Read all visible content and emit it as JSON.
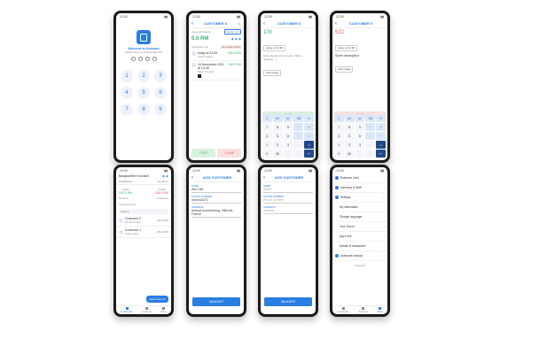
{
  "status_time": "12:00",
  "pin_screen": {
    "title": "Welcome to Konnash",
    "subtitle": "Please enter your Konnash PIN",
    "keys": [
      "1",
      "2",
      "3",
      "4",
      "5",
      "6",
      "7",
      "8",
      "9"
    ]
  },
  "customer_screen": {
    "title": "CUSTOMER 0",
    "balance_label": "General balance",
    "balance_badge": "Settled at 0",
    "balance_value": "0.0 RM",
    "operations_label": "Operations (2)",
    "report_label": "Generate report",
    "transactions": [
      {
        "date": "today at 22:36",
        "note": "Kevin, Gavin",
        "amount": "180.0 RM",
        "color": "green"
      },
      {
        "date": "16 November 2021 at 14:48",
        "note": "Bank Transfer",
        "amount": "+60.0 RM",
        "color": "green"
      }
    ],
    "got_label": "I GOT",
    "gave_label": "I GAVE"
  },
  "calc_green": {
    "title": "CUSTOMER 0",
    "amount": "100",
    "date_chip": "today at 22:38",
    "note_placeholder": "Enter details (Items name, Bill no, Quantity, ...)",
    "image_chip": "Add image",
    "save": "SAVE"
  },
  "calc_red": {
    "title": "CUSTOMER 0",
    "amount": "522",
    "date_chip": "today at 22:38",
    "note": "Some description",
    "image_chip": "Add image",
    "save": "SAVE"
  },
  "calc_keys": [
    "C",
    "M+",
    "M-",
    "⌫",
    "%",
    "7",
    "8",
    "9",
    "÷",
    "×",
    "4",
    "5",
    "6",
    "−",
    "+",
    "1",
    "2",
    "3",
    ".",
    "=",
    "0",
    "00",
    ",",
    "·",
    "↵"
  ],
  "list_screen": {
    "business": "Bangladeshi Konnash",
    "tabs": [
      "Customers",
      "Suppliers"
    ],
    "got_label": "I GOT",
    "gave_label": "I GAVE",
    "got_value": "100.0 RM",
    "gave_value": "186.0 RM",
    "reports": "Reports",
    "collection": "Collection",
    "customers_label": "Customers (2)",
    "search_placeholder": "Search",
    "customers": [
      {
        "name": "Customer 0",
        "sub": "18 hours ago",
        "amount": "100.0 RM",
        "color": "green"
      },
      {
        "name": "Customer 1",
        "sub": "3 days ago",
        "amount": "180.0 RM",
        "color": "red"
      }
    ],
    "add_button": "Add customer",
    "nav": [
      "Customers",
      "Analysis",
      "More"
    ]
  },
  "add_filled": {
    "title": "ADD CUSTOMER",
    "name_label": "NAME",
    "name_value": "Ann Dell",
    "phone_label": "PHONE NUMBER",
    "phone_value": "0xxxx44271",
    "address_label": "ADDRESS",
    "address_value": "avenue kronenbourg, Hillcroft, France",
    "save": "VALIDATE"
  },
  "add_empty": {
    "title": "ADD CUSTOMER",
    "name_label": "NAME",
    "name_value": "Name",
    "phone_label": "PHONE NUMBER",
    "phone_value": "Phone number",
    "address_label": "ADDRESS",
    "address_value": "Address",
    "save": "VALIDATE"
  },
  "settings_screen": {
    "items": [
      {
        "label": "Business Card",
        "sub": false
      },
      {
        "label": "Inventory & Staff",
        "sub": false
      },
      {
        "label": "Settings",
        "sub": false
      },
      {
        "label": "My information",
        "sub": true
      },
      {
        "label": "Change language",
        "sub": true
      },
      {
        "label": "Your Sound",
        "sub": true
      },
      {
        "label": "App Lock",
        "sub": true
      },
      {
        "label": "Details of transaction",
        "sub": true
      },
      {
        "label": "Automatic backup",
        "sub": false
      }
    ],
    "footer": "Konnash",
    "nav": [
      "Customers",
      "Analysis",
      "More"
    ]
  },
  "colors": {
    "accent": "#2a7de1",
    "green": "#3cb371",
    "red": "#e85c5c"
  }
}
